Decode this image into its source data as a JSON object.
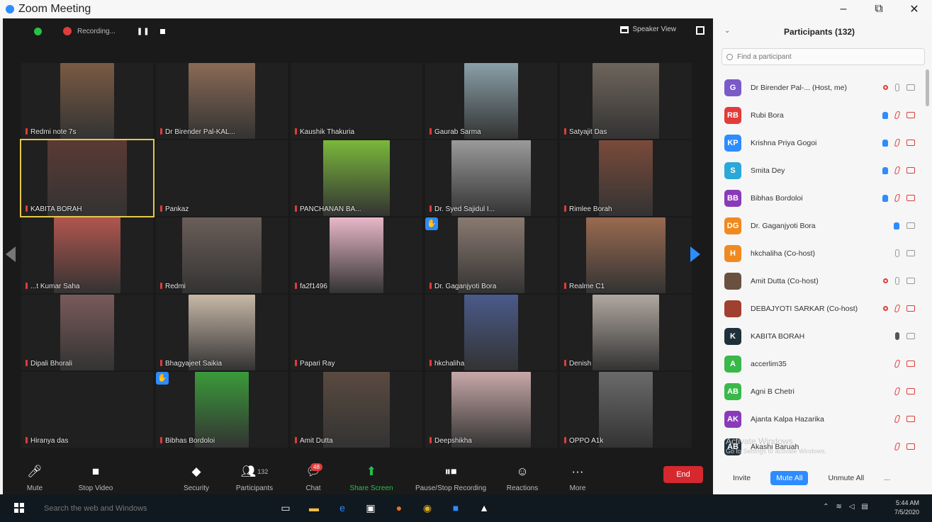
{
  "window": {
    "title": "Zoom Meeting",
    "minimize": "–",
    "maximize": "⧉",
    "close": "✕"
  },
  "topbar": {
    "recording_label": "Recording...",
    "speaker_view": "Speaker View"
  },
  "tiles": [
    {
      "name": "Redmi note 7s",
      "color": "#7a5a44",
      "hand": false,
      "active": false
    },
    {
      "name": "Dr Birender Pal-KAL...",
      "color": "#8a6a55",
      "hand": false,
      "active": false
    },
    {
      "name": "Kaushik Thakuria",
      "color": "#202020",
      "hand": false,
      "active": false
    },
    {
      "name": "Gaurab Sarma",
      "color": "#8aa0a8",
      "hand": false,
      "active": false
    },
    {
      "name": "Satyajit Das",
      "color": "#6e655c",
      "hand": false,
      "active": false
    },
    {
      "name": "KABITA BORAH",
      "color": "#5a3a35",
      "hand": false,
      "active": true
    },
    {
      "name": "Pankaz",
      "color": "#202020",
      "hand": false,
      "active": false
    },
    {
      "name": "PANCHANAN BA...",
      "color": "#7ab83a",
      "hand": false,
      "active": false
    },
    {
      "name": "Dr. Syed Sajidul I...",
      "color": "#9a9a9a",
      "hand": false,
      "active": false
    },
    {
      "name": "Rimlee Borah",
      "color": "#7a4a3a",
      "hand": false,
      "active": false
    },
    {
      "name": "...t Kumar Saha",
      "color": "#b0564e",
      "hand": false,
      "active": false
    },
    {
      "name": "Redmi",
      "color": "#6a5e58",
      "hand": false,
      "active": false
    },
    {
      "name": "fa2f1496",
      "color": "#e8b8c8",
      "hand": false,
      "active": false
    },
    {
      "name": "Dr. Gaganjyoti Bora",
      "color": "#8a7a70",
      "hand": true,
      "active": false
    },
    {
      "name": "Realme C1",
      "color": "#9a6a50",
      "hand": false,
      "active": false
    },
    {
      "name": "Dipali Bhorali",
      "color": "#7a5a5a",
      "hand": false,
      "active": false
    },
    {
      "name": "Bhagyajeet Saikia",
      "color": "#c8b8a8",
      "hand": false,
      "active": false
    },
    {
      "name": "Papari Ray",
      "color": "#202020",
      "hand": false,
      "active": false
    },
    {
      "name": "hkchaliha",
      "color": "#4a5a8a",
      "hand": false,
      "active": false
    },
    {
      "name": "Denish",
      "color": "#b0a8a0",
      "hand": false,
      "active": false
    },
    {
      "name": "Hiranya das",
      "color": "#202020",
      "hand": false,
      "active": false
    },
    {
      "name": "Bibhas Bordoloi",
      "color": "#3a9a3a",
      "hand": true,
      "active": false
    },
    {
      "name": "Amit Dutta",
      "color": "#5a4a40",
      "hand": false,
      "active": false
    },
    {
      "name": "Deepshikha",
      "color": "#c8a8a8",
      "hand": false,
      "active": false
    },
    {
      "name": "OPPO A1k",
      "color": "#6a6a6a",
      "hand": false,
      "active": false
    }
  ],
  "toolbar": {
    "mute": "Mute",
    "stop_video": "Stop Video",
    "security": "Security",
    "participants": "Participants",
    "participants_count": "132",
    "chat": "Chat",
    "chat_badge": "48",
    "share_screen": "Share Screen",
    "pause_stop_recording": "Pause/Stop Recording",
    "reactions": "Reactions",
    "more": "More",
    "end": "End"
  },
  "panel": {
    "title": "Participants (132)",
    "search_placeholder": "Find a participant",
    "participants": [
      {
        "initials": "G",
        "name": "Dr Birender Pal-... (Host, me)",
        "color": "#7a5ac8"
      },
      {
        "initials": "RB",
        "name": "Rubi Bora",
        "color": "#e23b3b"
      },
      {
        "initials": "KP",
        "name": "Krishna Priya Gogoi",
        "color": "#2d8cff"
      },
      {
        "initials": "S",
        "name": "Smita Dey",
        "color": "#2aa8d8"
      },
      {
        "initials": "BB",
        "name": "Bibhas Bordoloi",
        "color": "#8a3ab8"
      },
      {
        "initials": "DG",
        "name": "Dr. Gaganjyoti Bora",
        "color": "#f08a20"
      },
      {
        "initials": "H",
        "name": "hkchaliha (Co-host)",
        "color": "#f08a20"
      },
      {
        "initials": "",
        "name": "Amit Dutta (Co-host)",
        "color": "#6a5040"
      },
      {
        "initials": "",
        "name": "DEBAJYOTI SARKAR (Co-host)",
        "color": "#a04030"
      },
      {
        "initials": "K",
        "name": "KABITA BORAH",
        "color": "#20303a"
      },
      {
        "initials": "A",
        "name": "accerlim35",
        "color": "#3ab84a"
      },
      {
        "initials": "AB",
        "name": "Agni B Chetri",
        "color": "#3ab84a"
      },
      {
        "initials": "AK",
        "name": "Ajanta Kalpa Hazarika",
        "color": "#8a3ab8"
      },
      {
        "initials": "AB",
        "name": "Akashi Baruah",
        "color": "#20303a"
      }
    ],
    "invite": "Invite",
    "mute_all": "Mute All",
    "unmute_all": "Unmute All",
    "more": "..."
  },
  "watermark": {
    "line1": "Activate Windows",
    "line2": "Go to Settings to activate Windows."
  },
  "taskbar": {
    "search_placeholder": "Search the web and Windows",
    "time": "5:44 AM",
    "date": "7/5/2020"
  }
}
